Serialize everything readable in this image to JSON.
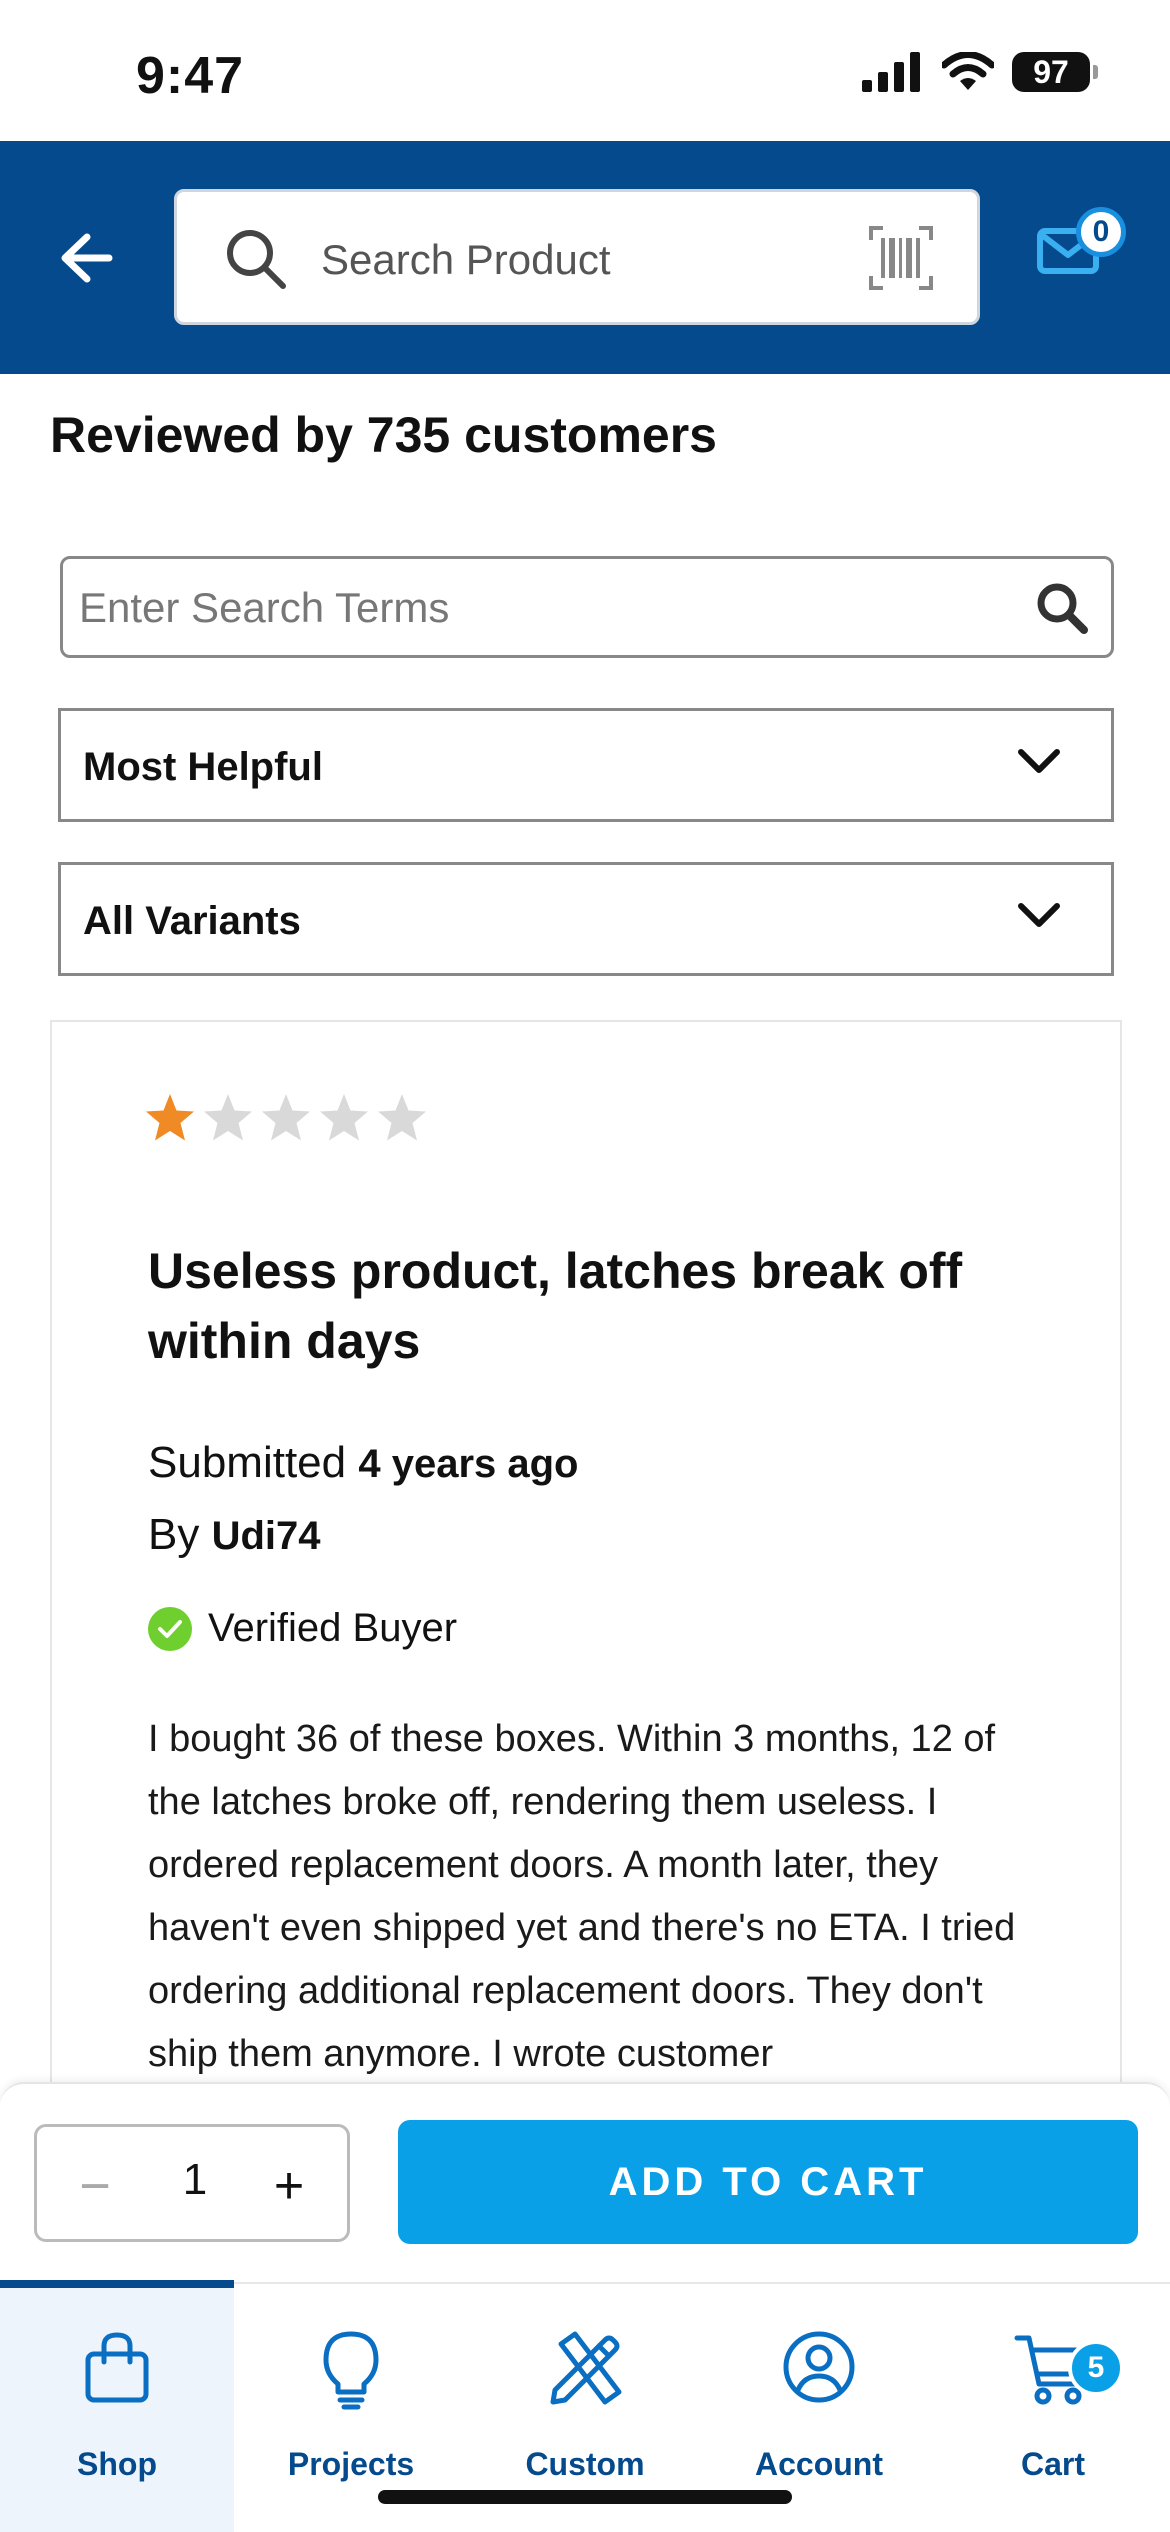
{
  "status_bar": {
    "time": "9:47",
    "battery": "97",
    "icons": [
      "signal-icon",
      "wifi-icon",
      "battery-icon"
    ]
  },
  "header": {
    "search_placeholder": "Search Product",
    "mail_count": "0",
    "icons": [
      "back-arrow-icon",
      "search-icon",
      "barcode-icon",
      "mail-icon"
    ]
  },
  "reviews": {
    "heading": "Reviewed by 735 customers",
    "search_placeholder": "Enter Search Terms",
    "sort_selected": "Most Helpful",
    "variant_selected": "All Variants"
  },
  "review": {
    "rating": 1,
    "max_rating": 5,
    "title": "Useless product, latches break off within days",
    "submitted_prefix": "Submitted",
    "submitted_value": "4 years ago",
    "by_prefix": "By",
    "author": "Udi74",
    "verified_label": "Verified Buyer",
    "body": "I bought 36 of these boxes. Within 3 months, 12 of the latches broke off, rendering them useless. I ordered replacement doors. A month later, they haven't even shipped yet and there's no ETA. I tried ordering additional replacement doors. They don't ship them anymore. I wrote customer"
  },
  "cart_bar": {
    "quantity": "1",
    "minus": "−",
    "plus": "+",
    "add_label": "ADD TO CART"
  },
  "tabs": [
    {
      "label": "Shop",
      "icon": "shopping-bag-icon"
    },
    {
      "label": "Projects",
      "icon": "lightbulb-icon"
    },
    {
      "label": "Custom",
      "icon": "pencil-ruler-icon"
    },
    {
      "label": "Account",
      "icon": "user-circle-icon"
    },
    {
      "label": "Cart",
      "icon": "cart-icon"
    }
  ],
  "cart_count": "5",
  "colors": {
    "header_bg": "#044a8c",
    "accent_blue": "#0aa0e8",
    "star_filled": "#f08a24",
    "star_empty": "#d9d9d9",
    "verified_green": "#6fcf2e"
  }
}
